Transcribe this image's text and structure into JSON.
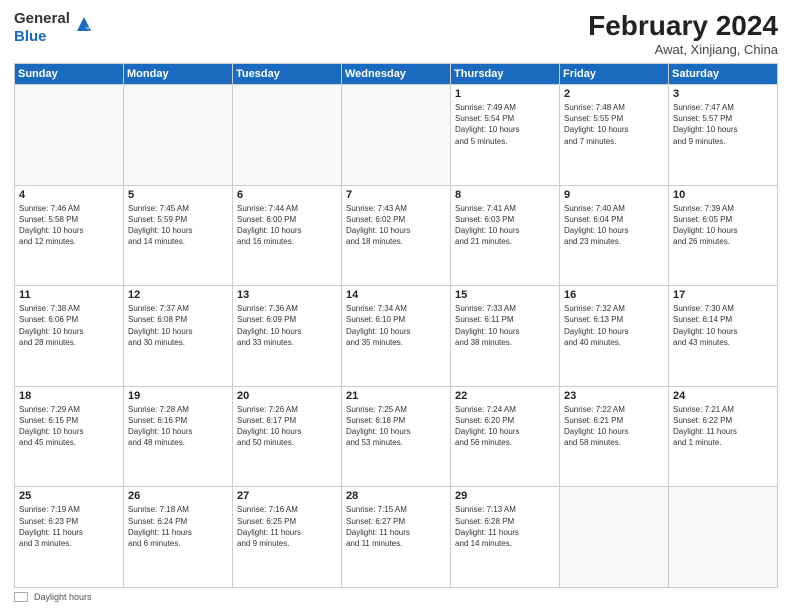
{
  "header": {
    "logo_line1": "General",
    "logo_line2": "Blue",
    "month_year": "February 2024",
    "location": "Awat, Xinjiang, China"
  },
  "weekdays": [
    "Sunday",
    "Monday",
    "Tuesday",
    "Wednesday",
    "Thursday",
    "Friday",
    "Saturday"
  ],
  "footer": {
    "legend_label": "Daylight hours"
  },
  "weeks": [
    [
      {
        "day": "",
        "info": ""
      },
      {
        "day": "",
        "info": ""
      },
      {
        "day": "",
        "info": ""
      },
      {
        "day": "",
        "info": ""
      },
      {
        "day": "1",
        "info": "Sunrise: 7:49 AM\nSunset: 5:54 PM\nDaylight: 10 hours\nand 5 minutes."
      },
      {
        "day": "2",
        "info": "Sunrise: 7:48 AM\nSunset: 5:55 PM\nDaylight: 10 hours\nand 7 minutes."
      },
      {
        "day": "3",
        "info": "Sunrise: 7:47 AM\nSunset: 5:57 PM\nDaylight: 10 hours\nand 9 minutes."
      }
    ],
    [
      {
        "day": "4",
        "info": "Sunrise: 7:46 AM\nSunset: 5:58 PM\nDaylight: 10 hours\nand 12 minutes."
      },
      {
        "day": "5",
        "info": "Sunrise: 7:45 AM\nSunset: 5:59 PM\nDaylight: 10 hours\nand 14 minutes."
      },
      {
        "day": "6",
        "info": "Sunrise: 7:44 AM\nSunset: 6:00 PM\nDaylight: 10 hours\nand 16 minutes."
      },
      {
        "day": "7",
        "info": "Sunrise: 7:43 AM\nSunset: 6:02 PM\nDaylight: 10 hours\nand 18 minutes."
      },
      {
        "day": "8",
        "info": "Sunrise: 7:41 AM\nSunset: 6:03 PM\nDaylight: 10 hours\nand 21 minutes."
      },
      {
        "day": "9",
        "info": "Sunrise: 7:40 AM\nSunset: 6:04 PM\nDaylight: 10 hours\nand 23 minutes."
      },
      {
        "day": "10",
        "info": "Sunrise: 7:39 AM\nSunset: 6:05 PM\nDaylight: 10 hours\nand 26 minutes."
      }
    ],
    [
      {
        "day": "11",
        "info": "Sunrise: 7:38 AM\nSunset: 6:06 PM\nDaylight: 10 hours\nand 28 minutes."
      },
      {
        "day": "12",
        "info": "Sunrise: 7:37 AM\nSunset: 6:08 PM\nDaylight: 10 hours\nand 30 minutes."
      },
      {
        "day": "13",
        "info": "Sunrise: 7:36 AM\nSunset: 6:09 PM\nDaylight: 10 hours\nand 33 minutes."
      },
      {
        "day": "14",
        "info": "Sunrise: 7:34 AM\nSunset: 6:10 PM\nDaylight: 10 hours\nand 35 minutes."
      },
      {
        "day": "15",
        "info": "Sunrise: 7:33 AM\nSunset: 6:11 PM\nDaylight: 10 hours\nand 38 minutes."
      },
      {
        "day": "16",
        "info": "Sunrise: 7:32 AM\nSunset: 6:13 PM\nDaylight: 10 hours\nand 40 minutes."
      },
      {
        "day": "17",
        "info": "Sunrise: 7:30 AM\nSunset: 6:14 PM\nDaylight: 10 hours\nand 43 minutes."
      }
    ],
    [
      {
        "day": "18",
        "info": "Sunrise: 7:29 AM\nSunset: 6:15 PM\nDaylight: 10 hours\nand 45 minutes."
      },
      {
        "day": "19",
        "info": "Sunrise: 7:28 AM\nSunset: 6:16 PM\nDaylight: 10 hours\nand 48 minutes."
      },
      {
        "day": "20",
        "info": "Sunrise: 7:26 AM\nSunset: 6:17 PM\nDaylight: 10 hours\nand 50 minutes."
      },
      {
        "day": "21",
        "info": "Sunrise: 7:25 AM\nSunset: 6:18 PM\nDaylight: 10 hours\nand 53 minutes."
      },
      {
        "day": "22",
        "info": "Sunrise: 7:24 AM\nSunset: 6:20 PM\nDaylight: 10 hours\nand 56 minutes."
      },
      {
        "day": "23",
        "info": "Sunrise: 7:22 AM\nSunset: 6:21 PM\nDaylight: 10 hours\nand 58 minutes."
      },
      {
        "day": "24",
        "info": "Sunrise: 7:21 AM\nSunset: 6:22 PM\nDaylight: 11 hours\nand 1 minute."
      }
    ],
    [
      {
        "day": "25",
        "info": "Sunrise: 7:19 AM\nSunset: 6:23 PM\nDaylight: 11 hours\nand 3 minutes."
      },
      {
        "day": "26",
        "info": "Sunrise: 7:18 AM\nSunset: 6:24 PM\nDaylight: 11 hours\nand 6 minutes."
      },
      {
        "day": "27",
        "info": "Sunrise: 7:16 AM\nSunset: 6:25 PM\nDaylight: 11 hours\nand 9 minutes."
      },
      {
        "day": "28",
        "info": "Sunrise: 7:15 AM\nSunset: 6:27 PM\nDaylight: 11 hours\nand 11 minutes."
      },
      {
        "day": "29",
        "info": "Sunrise: 7:13 AM\nSunset: 6:28 PM\nDaylight: 11 hours\nand 14 minutes."
      },
      {
        "day": "",
        "info": ""
      },
      {
        "day": "",
        "info": ""
      }
    ]
  ]
}
